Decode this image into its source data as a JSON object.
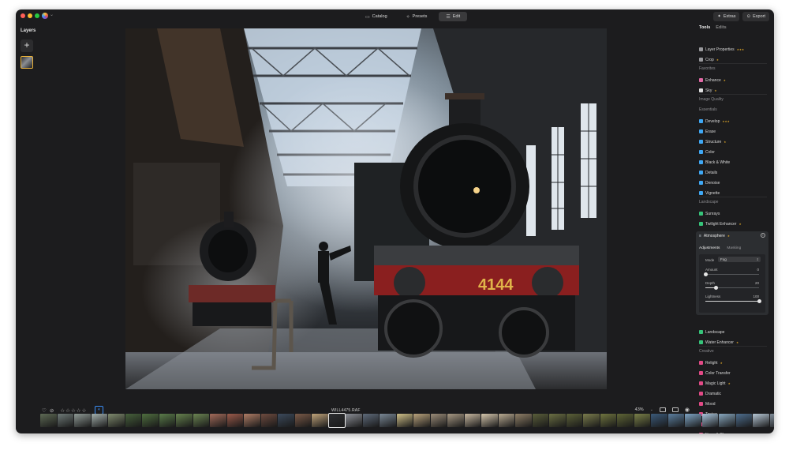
{
  "window": {
    "nav": [
      "Catalog",
      "Presets",
      "Edit"
    ],
    "nav_active": 2,
    "extras_label": "Extras",
    "export_label": "Export"
  },
  "layers": {
    "title": "Layers",
    "add_label": "+"
  },
  "tools": {
    "tabs": [
      "Tools",
      "Edits"
    ],
    "top_items": [
      {
        "label": "Layer Properties",
        "icon": "layers-icon",
        "color": "#9a9a9e",
        "stars": "★★★"
      },
      {
        "label": "Crop",
        "icon": "crop-icon",
        "color": "#9a9a9e",
        "stars": "★"
      }
    ],
    "favorites_label": "Favorites",
    "favorites": [
      {
        "label": "Enhance",
        "icon": "enhance-icon",
        "color": "#e36aa7",
        "stars": "★"
      },
      {
        "label": "Sky",
        "icon": "sky-icon",
        "color": "#e0e0e0",
        "stars": "★"
      }
    ],
    "image_quality_label": "Image Quality",
    "essentials_label": "Essentials",
    "essentials": [
      {
        "label": "Develop",
        "icon": "develop-icon",
        "color": "#3fa8f5",
        "stars": "★★★"
      },
      {
        "label": "Erase",
        "icon": "erase-icon",
        "color": "#3fa8f5",
        "stars": ""
      },
      {
        "label": "Structure",
        "icon": "structure-icon",
        "color": "#3fa8f5",
        "stars": "★"
      },
      {
        "label": "Color",
        "icon": "color-icon",
        "color": "#3fa8f5",
        "stars": ""
      },
      {
        "label": "Black & White",
        "icon": "black-white-icon",
        "color": "#3fa8f5",
        "stars": ""
      },
      {
        "label": "Details",
        "icon": "details-icon",
        "color": "#3fa8f5",
        "stars": ""
      },
      {
        "label": "Denoise",
        "icon": "denoise-icon",
        "color": "#3fa8f5",
        "stars": ""
      },
      {
        "label": "Vignette",
        "icon": "vignette-icon",
        "color": "#3fa8f5",
        "stars": ""
      }
    ],
    "landscape_label": "Landscape",
    "landscape": [
      {
        "label": "Sunrays",
        "icon": "sunrays-icon",
        "color": "#36c47a",
        "stars": ""
      },
      {
        "label": "Twilight Enhancer",
        "icon": "twilight-icon",
        "color": "#36c47a",
        "stars": "★"
      }
    ],
    "atmosphere": {
      "title": "Atmosphere",
      "stars": "★",
      "tabs": [
        "Adjustments",
        "Masking"
      ],
      "mode_label": "Mode",
      "mode_value": "Fog",
      "sliders": [
        {
          "label": "Amount",
          "value": "0",
          "fraction": 0
        },
        {
          "label": "Depth",
          "value": "20",
          "fraction": 0.2
        },
        {
          "label": "Lightness",
          "value": "100",
          "fraction": 1
        }
      ]
    },
    "after_atmo": [
      {
        "label": "Landscape",
        "icon": "landscape-icon",
        "color": "#36c47a",
        "stars": ""
      },
      {
        "label": "Water Enhancer",
        "icon": "water-icon",
        "color": "#36c47a",
        "stars": "★"
      }
    ],
    "creative_label": "Creative",
    "creative": [
      {
        "label": "Relight",
        "icon": "relight-icon",
        "color": "#e24a86",
        "stars": "★"
      },
      {
        "label": "Color Transfer",
        "icon": "color-transfer-icon",
        "color": "#e24a86",
        "stars": ""
      },
      {
        "label": "Magic Light",
        "icon": "magic-light-icon",
        "color": "#e24a86",
        "stars": "★"
      },
      {
        "label": "Dramatic",
        "icon": "dramatic-icon",
        "color": "#e24a86",
        "stars": ""
      },
      {
        "label": "Mood",
        "icon": "mood-icon",
        "color": "#e24a86",
        "stars": ""
      },
      {
        "label": "Toning",
        "icon": "toning-icon",
        "color": "#e24a86",
        "stars": ""
      },
      {
        "label": "Matte",
        "icon": "matte-icon",
        "color": "#e24a86",
        "stars": ""
      },
      {
        "label": "Neon & Glow",
        "icon": "neon-glow-icon",
        "color": "#e24a86",
        "stars": ""
      }
    ]
  },
  "bottombar": {
    "filename": "WILL4475.RAF",
    "zoom": "43%",
    "rating_stars": 5
  },
  "filmstrip": {
    "selected_index": 17,
    "colors": [
      "#5e6a55",
      "#6f7a78",
      "#8f9a96",
      "#a4b0ad",
      "#7f8a6e",
      "#46603b",
      "#4f6e3f",
      "#5a7c4a",
      "#66824e",
      "#6b8452",
      "#a36b5a",
      "#9a5a4a",
      "#b07d66",
      "#6e4b3f",
      "#3c4a5c",
      "#7a5a48",
      "#c0a37a",
      "#2d2e31",
      "#8b8e96",
      "#5e6a7a",
      "#7a8896",
      "#d0c088",
      "#b9a27c",
      "#9b8c79",
      "#a79883",
      "#c8b8a0",
      "#d6c7ad",
      "#b9aa91",
      "#8f7f67",
      "#5a5e3a",
      "#6b6f43",
      "#5c6138",
      "#7a7c4c",
      "#70753f",
      "#5f6536",
      "#7a8048",
      "#3b5a7a",
      "#5c7fa0",
      "#7ea4c4",
      "#a6c4dc",
      "#88a8c0",
      "#4e6e8e",
      "#b8c9d8",
      "#7f8c99"
    ]
  }
}
